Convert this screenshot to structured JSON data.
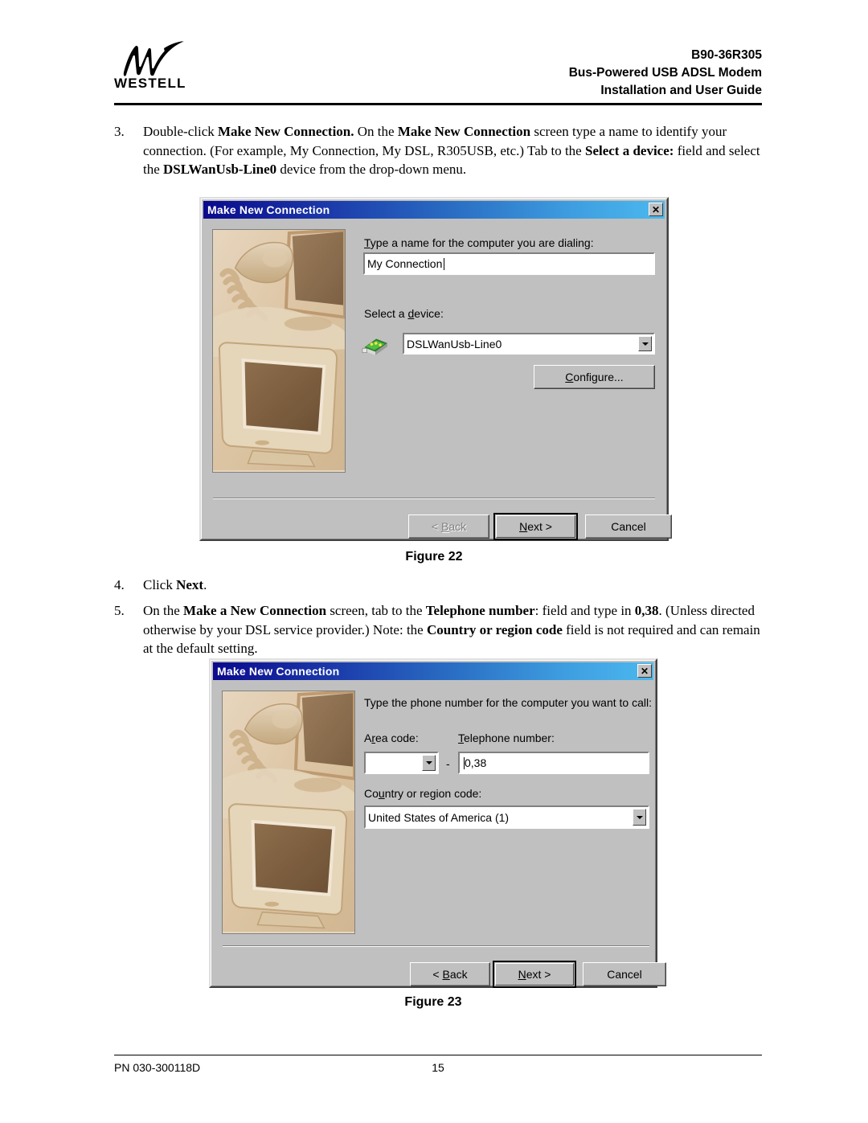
{
  "header": {
    "logo_word": "WESTELL",
    "line1": "B90-36R305",
    "line2": "Bus-Powered USB ADSL Modem",
    "line3": "Installation and User Guide"
  },
  "steps": {
    "step3": {
      "num": "3.",
      "p1": "Double-click ",
      "b1": "Make New Connection.",
      "p2": " On the ",
      "b2": "Make New Connection",
      "p3": " screen type a name to identify your connection.  (For example, My Connection, My DSL, R305USB, etc.) Tab to the ",
      "b3": "Select a device:",
      "p4": " field and select the ",
      "b4": "DSLWanUsb-Line0",
      "p5": " device from the drop-down menu."
    },
    "step4": {
      "num": "4.",
      "p1": "Click ",
      "b1": "Next",
      "p2": "."
    },
    "step5": {
      "num": "5.",
      "p1": "On the ",
      "b1": "Make a New Connection",
      "p2": " screen, tab to the ",
      "b2": "Telephone number",
      "p3": ": field and type in ",
      "b3": "0,38",
      "p4": ". (Unless directed otherwise by your DSL service provider.)  Note: the ",
      "b4": "Country or region code",
      "p5": " field is not required and can remain at the default setting."
    }
  },
  "dialog1": {
    "title": "Make New Connection",
    "close_label": "✕",
    "name_label_pre": "T",
    "name_label_rest": "ype a name for the computer you are dialing:",
    "name_value": "My Connection",
    "device_label_pre": "Select a ",
    "device_label_key": "d",
    "device_label_rest": "evice:",
    "device_value": "DSLWanUsb-Line0",
    "configure_label_key": "C",
    "configure_label_rest": "onfigure...",
    "back_label": "< Back",
    "back_key": "B",
    "back_pre": "< ",
    "back_rest": "ack",
    "next_pre": "",
    "next_key": "N",
    "next_rest": "ext >",
    "cancel_label": "Cancel"
  },
  "figure22": "Figure  22",
  "dialog2": {
    "title": "Make New Connection",
    "close_label": "✕",
    "prompt": "Type the phone number for the computer you want to call:",
    "area_label_pre": "A",
    "area_label_key": "r",
    "area_label_rest": "ea code:",
    "area_value": "",
    "dash": "-",
    "phone_label_key": "T",
    "phone_label_rest": "elephone number:",
    "phone_value": "0,38",
    "country_label_pre": "Co",
    "country_label_key": "u",
    "country_label_rest": "ntry or region code:",
    "country_value": "United States of America (1)",
    "back_pre": "< ",
    "back_key": "B",
    "back_rest": "ack",
    "next_key": "N",
    "next_rest": "ext >",
    "cancel_label": "Cancel"
  },
  "figure23": "Figure  23",
  "footer": {
    "pn": "PN 030-300118D",
    "page": "15"
  }
}
